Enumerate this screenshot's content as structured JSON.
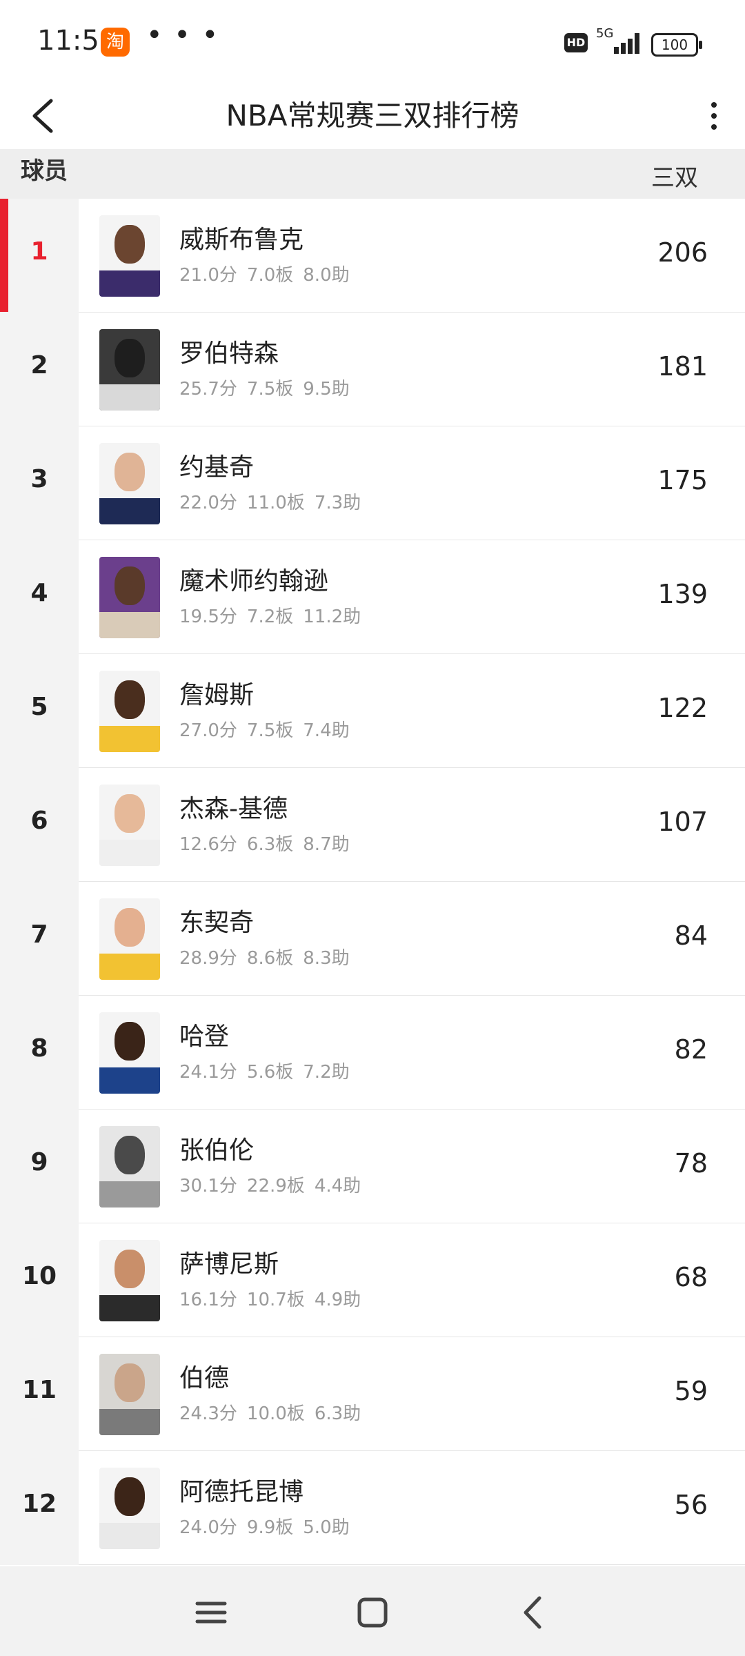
{
  "status_bar": {
    "time": "11:59",
    "app_badge_text": "淘",
    "more_dots": "• • •",
    "hd": "HD",
    "network": "5G",
    "battery": "100"
  },
  "nav": {
    "title": "NBA常规赛三双排行榜"
  },
  "table": {
    "col_player": "球员",
    "col_td": "三双"
  },
  "rows": [
    {
      "rank": "1",
      "name": "威斯布鲁克",
      "pts": "21.0分",
      "reb": "7.0板",
      "ast": "8.0助",
      "td": "206"
    },
    {
      "rank": "2",
      "name": "罗伯特森",
      "pts": "25.7分",
      "reb": "7.5板",
      "ast": "9.5助",
      "td": "181"
    },
    {
      "rank": "3",
      "name": "约基奇",
      "pts": "22.0分",
      "reb": "11.0板",
      "ast": "7.3助",
      "td": "175"
    },
    {
      "rank": "4",
      "name": "魔术师约翰逊",
      "pts": "19.5分",
      "reb": "7.2板",
      "ast": "11.2助",
      "td": "139"
    },
    {
      "rank": "5",
      "name": "詹姆斯",
      "pts": "27.0分",
      "reb": "7.5板",
      "ast": "7.4助",
      "td": "122"
    },
    {
      "rank": "6",
      "name": "杰森-基德",
      "pts": "12.6分",
      "reb": "6.3板",
      "ast": "8.7助",
      "td": "107"
    },
    {
      "rank": "7",
      "name": "东契奇",
      "pts": "28.9分",
      "reb": "8.6板",
      "ast": "8.3助",
      "td": "84"
    },
    {
      "rank": "8",
      "name": "哈登",
      "pts": "24.1分",
      "reb": "5.6板",
      "ast": "7.2助",
      "td": "82"
    },
    {
      "rank": "9",
      "name": "张伯伦",
      "pts": "30.1分",
      "reb": "22.9板",
      "ast": "4.4助",
      "td": "78"
    },
    {
      "rank": "10",
      "name": "萨博尼斯",
      "pts": "16.1分",
      "reb": "10.7板",
      "ast": "4.9助",
      "td": "68"
    },
    {
      "rank": "11",
      "name": "伯德",
      "pts": "24.3分",
      "reb": "10.0板",
      "ast": "6.3助",
      "td": "59"
    },
    {
      "rank": "12",
      "name": "阿德托昆博",
      "pts": "24.0分",
      "reb": "9.9板",
      "ast": "5.0助",
      "td": "56"
    }
  ],
  "colors": {
    "accent_red": "#e8202e",
    "rank_bg": "#f3f3f3",
    "header_bg": "#eeeeee",
    "stats_gray": "#9a9a9a"
  },
  "icons": {
    "back": "chevron-left-icon",
    "menu": "more-vertical-icon",
    "nav_menu": "hamburger-icon",
    "nav_home": "square-home-icon",
    "nav_back": "chevron-left-icon"
  }
}
